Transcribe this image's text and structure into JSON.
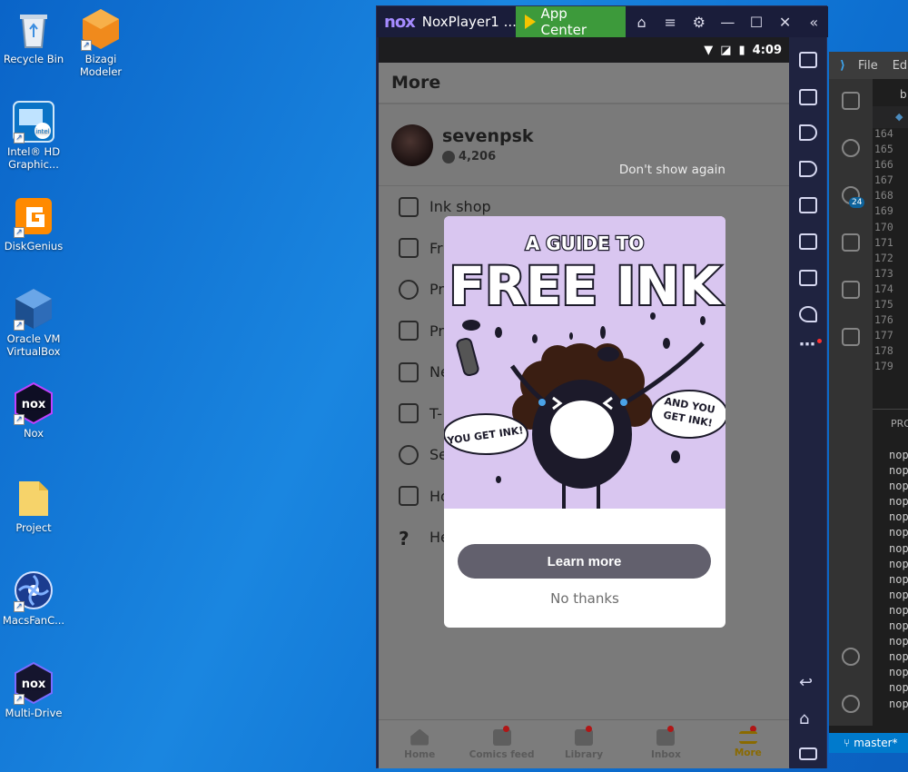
{
  "desktop": {
    "icons": [
      {
        "label": "Recycle Bin",
        "icon": "recycle-bin-icon"
      },
      {
        "label": "Bizagi Modeler",
        "icon": "bizagi-icon"
      },
      {
        "label": "Intel® HD Graphic...",
        "icon": "intel-graphics-icon"
      },
      {
        "label": "DiskGenius",
        "icon": "diskgenius-icon"
      },
      {
        "label": "Oracle VM VirtualBox",
        "icon": "virtualbox-icon"
      },
      {
        "label": "Nox",
        "icon": "nox-icon"
      },
      {
        "label": "Project",
        "icon": "folder-icon"
      },
      {
        "label": "MacsFanC...",
        "icon": "macsfan-icon"
      },
      {
        "label": "Multi-Drive",
        "icon": "multidrive-icon"
      }
    ]
  },
  "nox": {
    "logo": "nox",
    "title": "NoxPlayer1 ...",
    "app_center": "App Center",
    "status_time": "4:09"
  },
  "app": {
    "header": "More",
    "username": "sevenpsk",
    "coins": "4,206",
    "dont_show": "Don't show again",
    "menu": [
      {
        "label": "Ink shop"
      },
      {
        "label": "Fr"
      },
      {
        "label": "Pr"
      },
      {
        "label": "Pr"
      },
      {
        "label": "Ne"
      },
      {
        "label": "T-"
      },
      {
        "label": "Se"
      },
      {
        "label": "Ho"
      },
      {
        "label": "He"
      }
    ],
    "nav": [
      {
        "label": "Home"
      },
      {
        "label": "Comics feed"
      },
      {
        "label": "Library"
      },
      {
        "label": "Inbox"
      },
      {
        "label": "More"
      }
    ]
  },
  "modal": {
    "art_title_top": "A GUIDE TO",
    "art_title_main": "FREE INK",
    "bubble_left": "YOU GET INK!",
    "bubble_right_1": "AND YOU",
    "bubble_right_2": "GET INK!",
    "learn_more": "Learn more",
    "no_thanks": "No thanks"
  },
  "vscode": {
    "menu_file": "File",
    "menu_edit": "Ed",
    "tab": "b",
    "badge": "24",
    "panel": "PRO",
    "branch": "master*",
    "line_numbers": [
      "164",
      "165",
      "166",
      "167",
      "168",
      "169",
      "170",
      "171",
      "172",
      "173",
      "174",
      "175",
      "176",
      "177",
      "178",
      "179"
    ],
    "terminal": [
      "nop",
      "nop",
      "nop",
      "nop",
      "nop",
      "nop",
      "nop",
      "nop",
      "nop",
      "nop",
      "nop",
      "nop",
      "nop",
      "nop",
      "nop",
      "nop",
      "nop"
    ]
  },
  "colors": {
    "desktop_bg": "#1677d8",
    "app_center": "#3d9a3b",
    "learn_button": "#62606d",
    "vscode_status": "#007acc"
  }
}
